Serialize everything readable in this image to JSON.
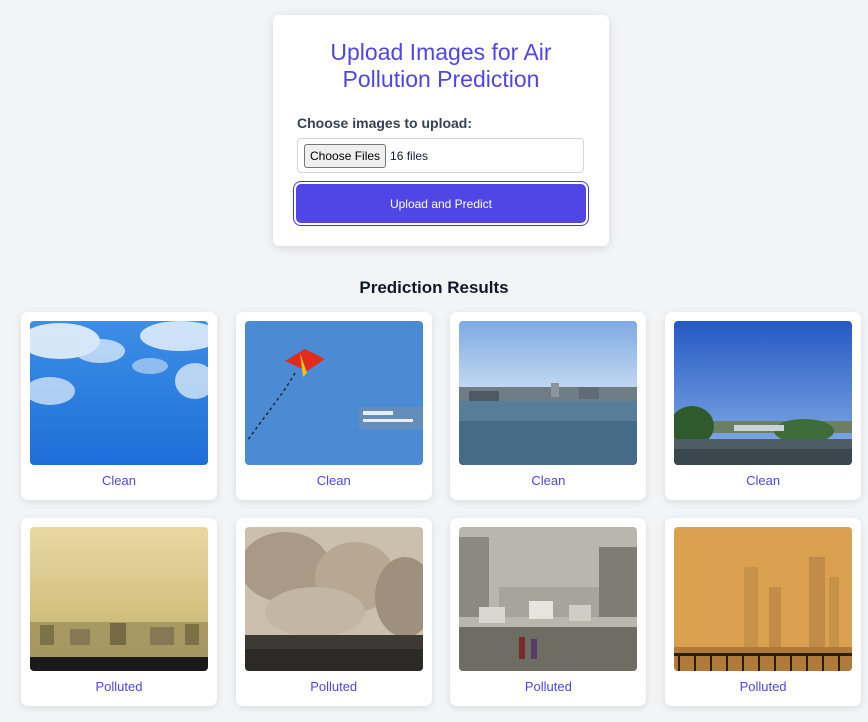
{
  "upload": {
    "title": "Upload Images for Air Pollution Prediction",
    "choose_label": "Choose images to upload:",
    "file_button": "Choose Files",
    "file_status": "16 files",
    "submit_label": "Upload and Predict"
  },
  "results": {
    "title": "Prediction Results",
    "items": [
      {
        "label": "Clean"
      },
      {
        "label": "Clean"
      },
      {
        "label": "Clean"
      },
      {
        "label": "Clean"
      },
      {
        "label": "Polluted"
      },
      {
        "label": "Polluted"
      },
      {
        "label": "Polluted"
      },
      {
        "label": "Polluted"
      }
    ]
  },
  "colors": {
    "accent": "#4f46e5",
    "background": "#f3f4f6",
    "card": "#ffffff"
  }
}
